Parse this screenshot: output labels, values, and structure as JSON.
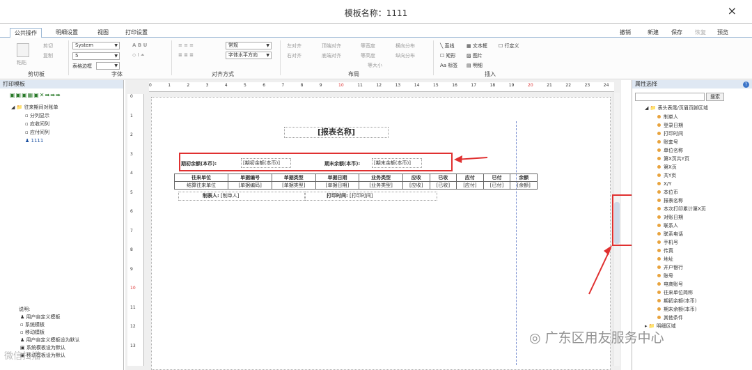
{
  "window": {
    "title": "模板名称：1111",
    "close_glyph": "×"
  },
  "tabs": [
    "公共操作",
    "明细设置",
    "视图",
    "打印设置"
  ],
  "right_tools": [
    "撤销",
    "新建",
    "保存",
    "恢复",
    "预览"
  ],
  "ribbon": {
    "clipboard": {
      "paste": "粘贴",
      "cut": "剪切",
      "copy": "复制",
      "label": "剪切板"
    },
    "font": {
      "family": "System",
      "size": "5",
      "border": "表格边框",
      "label": "字体"
    },
    "align": {
      "style": "常规",
      "hint": "字体水平方向",
      "label": "对齐方式"
    },
    "layout": {
      "items": [
        "左对齐",
        "顶端对齐",
        "等宽度",
        "横向分布",
        "右对齐",
        "底端对齐",
        "等高度",
        "纵向分布",
        "等大小"
      ],
      "label": "布局"
    },
    "insert": {
      "items": [
        "直线",
        "文本框",
        "行定义",
        "矩形",
        "图片",
        "标签",
        "明细"
      ],
      "label": "插入"
    }
  },
  "left_panel": {
    "title": "打印模板",
    "tree": {
      "root": "往来期间对账单",
      "children": [
        "分列显示",
        "应收间列",
        "应付间列",
        "1111"
      ]
    },
    "legend_title": "说明:",
    "legend": [
      "用户自定义模板",
      "系统模板",
      "移动模板",
      "用户自定义模板设为默认",
      "系统模板设为默认",
      "移动模板设为默认"
    ]
  },
  "ruler_h": [
    "0",
    "1",
    "2",
    "3",
    "4",
    "5",
    "6",
    "7",
    "8",
    "9",
    "10",
    "11",
    "12",
    "13",
    "14",
    "15",
    "16",
    "17",
    "18",
    "19",
    "20",
    "21",
    "22",
    "23",
    "24"
  ],
  "ruler_v": [
    "0",
    "1",
    "2",
    "3",
    "4",
    "5",
    "6",
    "7",
    "8",
    "9",
    "10",
    "11",
    "12",
    "13"
  ],
  "report": {
    "title": "[报表名称]",
    "opening_label": "期初余额(本币):",
    "opening_value": "[期初余额(本币)]",
    "closing_label": "期末余额(本币):",
    "closing_value": "[期末余额(本币)]",
    "headers": [
      "往来单位",
      "单据编号",
      "单据类型",
      "单据日期",
      "业务类型",
      "应收",
      "已收",
      "应付",
      "已付",
      "余额"
    ],
    "row": [
      "结算往来单位",
      "[单据编码]",
      "[单据类型]",
      "[单据日期]",
      "[业务类型]",
      "[应收]",
      "[已收]",
      "[应付]",
      "[已付]",
      "[余额]"
    ],
    "maker_label": "制表人:",
    "maker_value": "[制单人]",
    "print_label": "打印时间:",
    "print_value": "[打印时间]"
  },
  "right_panel": {
    "title": "属性选择",
    "search_button": "搜索",
    "group": "表头表尾/页眉页脚区域",
    "items": [
      "制单人",
      "登录日期",
      "打印时间",
      "账套号",
      "单位名称",
      "第X页共Y页",
      "第X页",
      "共Y页",
      "X/Y",
      "本位币",
      "报表名称",
      "本次打印累计第X页",
      "对账日期",
      "联系人",
      "联系电话",
      "手机号",
      "传真",
      "地址",
      "开户银行",
      "账号",
      "电商账号",
      "往来单位简称",
      "期初余额(本币)",
      "期末余额(本币)",
      "其他条件"
    ],
    "group2": "明细区域"
  },
  "watermarks": [
    "广东区用友服务中心",
    "微信扫描"
  ],
  "colors": {
    "accent_red": "#e03030",
    "panel_header": "#dfe8f3"
  }
}
